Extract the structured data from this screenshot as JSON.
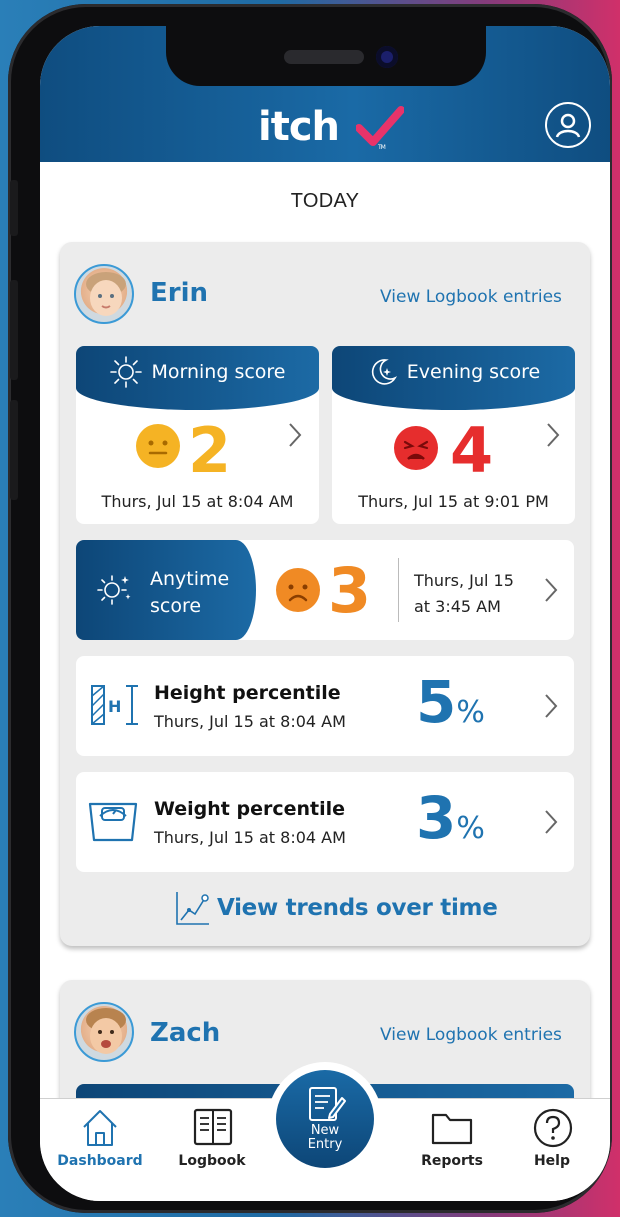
{
  "app": {
    "logo_text": "itch",
    "logo_tm": "TM"
  },
  "header": {
    "profile_icon": "user-circle-icon"
  },
  "page": {
    "title": "TODAY"
  },
  "children": [
    {
      "name": "Erin",
      "view_link": "View Logbook entries",
      "morning": {
        "label": "Morning score",
        "value": "2",
        "date": "Thurs, Jul 15 at 8:04 AM",
        "face_color": "#f5b324",
        "mood": "neutral"
      },
      "evening": {
        "label": "Evening score",
        "value": "4",
        "date": "Thurs, Jul 15 at 9:01 PM",
        "face_color": "#e62d2d",
        "mood": "angry"
      },
      "anytime": {
        "label_line1": "Anytime",
        "label_line2": "score",
        "value": "3",
        "date_line1": "Thurs, Jul 15",
        "date_line2": "at 3:45 AM",
        "face_color": "#f08a24",
        "mood": "sad"
      },
      "height": {
        "label": "Height percentile",
        "date": "Thurs, Jul 15 at 8:04 AM",
        "value": "5",
        "unit": "%"
      },
      "weight": {
        "label": "Weight percentile",
        "date": "Thurs, Jul 15 at 8:04 AM",
        "value": "3",
        "unit": "%"
      },
      "trends_label": "View trends over time"
    },
    {
      "name": "Zach",
      "view_link": "View Logbook entries"
    }
  ],
  "tabbar": {
    "items": [
      {
        "label": "Dashboard",
        "icon": "house-icon",
        "active": true
      },
      {
        "label": "Logbook",
        "icon": "book-icon",
        "active": false
      },
      {
        "label_line1": "New",
        "label_line2": "Entry",
        "icon": "pencil-note-icon",
        "active": false
      },
      {
        "label": "Reports",
        "icon": "folder-icon",
        "active": false
      },
      {
        "label": "Help",
        "icon": "question-circle-icon",
        "active": false
      }
    ]
  },
  "colors": {
    "brand_blue": "#1f73b0",
    "header_dark": "#0d4677",
    "accent_pink": "#e8336a",
    "yellow": "#f5b324",
    "red": "#e62d2d",
    "orange": "#f08a24"
  }
}
